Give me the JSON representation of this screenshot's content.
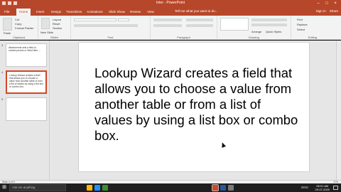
{
  "window": {
    "title": "Inter - PowerPoint",
    "sign_in": "Sign in",
    "share": "Share"
  },
  "tabs": [
    "File",
    "Home",
    "Insert",
    "Design",
    "Transitions",
    "Animations",
    "Slide Show",
    "Review",
    "View"
  ],
  "active_tab": "Home",
  "tell_me": "Tell me what you want to do...",
  "ribbon": {
    "groups": {
      "clipboard": "Clipboard",
      "slides": "Slides",
      "font": "Font",
      "paragraph": "Paragraph",
      "drawing": "Drawing",
      "editing": "Editing"
    },
    "clipboard_items": [
      "Cut",
      "Copy",
      "Format Painter"
    ],
    "paste": "Paste",
    "new_slide": "New Slide",
    "slides_items": [
      "Layout",
      "Reset",
      "Section"
    ],
    "drawing_items": [
      "Arrange",
      "Quick Styles"
    ],
    "editing_items": [
      "Find",
      "Replace",
      "Select"
    ]
  },
  "thumbnails": [
    {
      "num": "3",
      "text": "Attachments sets a field to contain photos or Word files, ..."
    },
    {
      "num": "4",
      "text": "Lookup Wizard creates a field that allows you to choose a value from another table or from a list of values by using a list box or combo box."
    },
    {
      "num": "5",
      "text": ""
    }
  ],
  "slide": {
    "body": "Lookup Wizard creates a field that allows you to choose a value from another table or from a list of values by using a list box or combo box."
  },
  "status": {
    "left": "Slide 4 of 9",
    "zoom": "71%"
  },
  "taskbar": {
    "search_placeholder": "Ask me anything",
    "time": "08:01 AM",
    "date": "29-07-2020",
    "tray": "ENG"
  }
}
